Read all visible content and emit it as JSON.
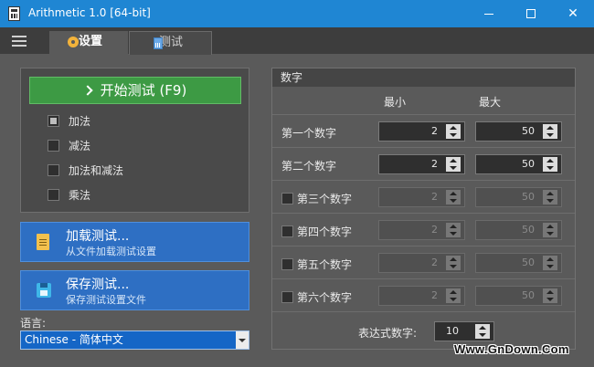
{
  "window": {
    "title": "Arithmetic 1.0  [64-bit]",
    "controls": {
      "minimize": "",
      "maximize": "",
      "close": "✕"
    }
  },
  "tabs": [
    {
      "label": "设置",
      "icon": "gear-icon",
      "active": true
    },
    {
      "label": "测试",
      "icon": "calculator-icon",
      "active": false
    }
  ],
  "settings": {
    "start_button": "开始测试 (F9)",
    "operations": [
      {
        "label": "加法",
        "checked": true
      },
      {
        "label": "减法",
        "checked": false
      },
      {
        "label": "加法和减法",
        "checked": false
      },
      {
        "label": "乘法",
        "checked": false
      }
    ],
    "load_button": {
      "title": "加载测试...",
      "subtitle": "从文件加载测试设置",
      "icon": "file-icon"
    },
    "save_button": {
      "title": "保存测试...",
      "subtitle": "保存测试设置文件",
      "icon": "save-disk-icon"
    },
    "language": {
      "label": "语言:",
      "selected": "Chinese  -  简体中文"
    }
  },
  "numbers": {
    "group_title": "数字",
    "min_header": "最小",
    "max_header": "最大",
    "rows": [
      {
        "label": "第一个数字",
        "has_checkbox": false,
        "enabled": true,
        "min": "2",
        "max": "50"
      },
      {
        "label": "第二个数字",
        "has_checkbox": false,
        "enabled": true,
        "min": "2",
        "max": "50"
      },
      {
        "label": "第三个数字",
        "has_checkbox": true,
        "enabled": false,
        "min": "2",
        "max": "50"
      },
      {
        "label": "第四个数字",
        "has_checkbox": true,
        "enabled": false,
        "min": "2",
        "max": "50"
      },
      {
        "label": "第五个数字",
        "has_checkbox": true,
        "enabled": false,
        "min": "2",
        "max": "50"
      },
      {
        "label": "第六个数字",
        "has_checkbox": true,
        "enabled": false,
        "min": "2",
        "max": "50"
      }
    ],
    "expressions_label": "表达式数字:",
    "expressions_value": "10"
  },
  "watermark": "Www.GnDown.Com",
  "colors": {
    "titlebar": "#1f86d3",
    "start_button": "#3d9a44",
    "action_button": "#2e6fc3",
    "background": "#5a5a5a"
  }
}
